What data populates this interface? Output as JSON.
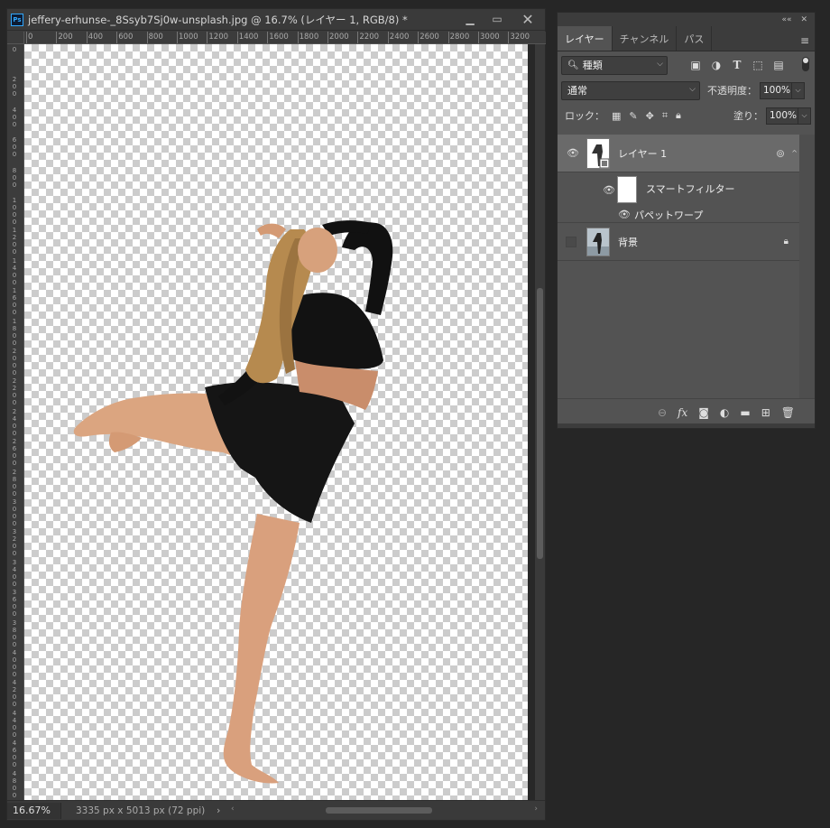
{
  "document": {
    "title": "jeffery-erhunse-_8Ssyb7Sj0w-unsplash.jpg @ 16.7% (レイヤー 1, RGB/8) *",
    "zoom": "16.67%",
    "info": "3335 px x 5013 px (72 ppi)",
    "ruler_h": [
      "0",
      "200",
      "400",
      "600",
      "800",
      "1000",
      "1200",
      "1400",
      "1600",
      "1800",
      "2000",
      "2200",
      "2400",
      "2600",
      "2800",
      "3000",
      "3200"
    ],
    "ruler_v": [
      "0",
      "200",
      "400",
      "600",
      "800",
      "1000",
      "1200",
      "1400",
      "1600",
      "1800",
      "2000",
      "2200",
      "2400",
      "2600",
      "2800",
      "3000",
      "3200",
      "3400",
      "3600",
      "3800",
      "4000",
      "4200",
      "4400",
      "4600",
      "4800"
    ]
  },
  "window_buttons": {
    "minimize": "▁",
    "maximize": "▭",
    "close": "✕"
  },
  "panel": {
    "collapse": "««",
    "close": "✕",
    "tabs": [
      "レイヤー",
      "チャンネル",
      "パス"
    ],
    "kind_filter": "種類",
    "blend_mode": "通常",
    "opacity_label": "不透明度：",
    "opacity_value": "100%",
    "lock_label": "ロック：",
    "fill_label": "塗り：",
    "fill_value": "100%",
    "layers": [
      {
        "name": "レイヤー 1",
        "visible": true,
        "selected": true
      },
      {
        "name": "背景",
        "visible": false,
        "selected": false,
        "locked": true
      }
    ],
    "smart_filter_label": "スマートフィルター",
    "puppet_warp_label": "パペットワープ",
    "bottom_icons": [
      "link-icon",
      "fx-icon",
      "mask-icon",
      "adjustment-icon",
      "folder-icon",
      "new-layer-icon",
      "trash-icon"
    ]
  }
}
